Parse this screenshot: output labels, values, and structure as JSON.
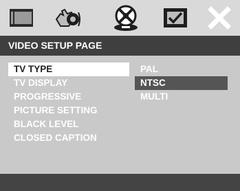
{
  "tabs": [
    {
      "icon": "general-setup-icon"
    },
    {
      "icon": "audio-setup-icon"
    },
    {
      "icon": "video-setup-icon"
    },
    {
      "icon": "preference-icon"
    },
    {
      "icon": "exit-icon"
    }
  ],
  "header": {
    "title": "VIDEO SETUP PAGE"
  },
  "menu": {
    "items": [
      {
        "label": "TV TYPE"
      },
      {
        "label": "TV DISPLAY"
      },
      {
        "label": "PROGRESSIVE"
      },
      {
        "label": "PICTURE SETTING"
      },
      {
        "label": "BLACK LEVEL"
      },
      {
        "label": "CLOSED CAPTION"
      }
    ],
    "active_index": 0
  },
  "options": {
    "items": [
      {
        "label": "PAL"
      },
      {
        "label": "NTSC"
      },
      {
        "label": "MULTI"
      }
    ],
    "selected_index": 1
  },
  "colors": {
    "background": "#c9c9c9",
    "header_bar": "#3f3f3f",
    "highlight": "#ffffff",
    "selected": "#555555",
    "footer": "#444444"
  }
}
